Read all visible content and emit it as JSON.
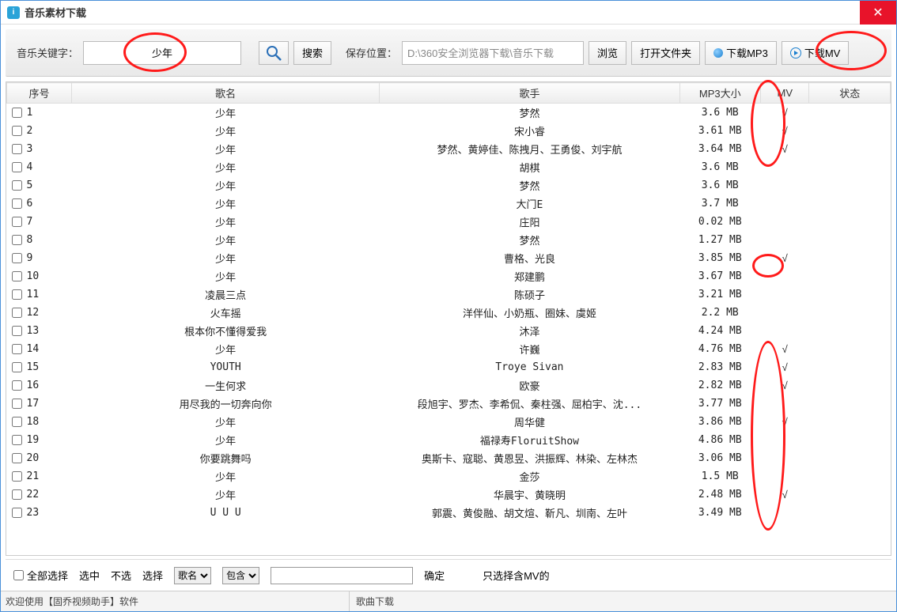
{
  "window": {
    "title": "音乐素材下载"
  },
  "toolbar": {
    "keyword_label": "音乐关键字：",
    "keyword_value": "少年",
    "search_label": "搜索",
    "save_label": "保存位置：",
    "save_path": "D:\\360安全浏览器下载\\音乐下载",
    "browse_label": "浏览",
    "open_folder_label": "打开文件夹",
    "download_mp3_label": "下载MP3",
    "download_mv_label": "下载MV"
  },
  "columns": {
    "seq": "序号",
    "name": "歌名",
    "artist": "歌手",
    "size": "MP3大小",
    "mv": "MV",
    "status": "状态"
  },
  "rows": [
    {
      "seq": "1",
      "name": "少年",
      "artist": "梦然",
      "size": "3.6 MB",
      "mv": "√"
    },
    {
      "seq": "2",
      "name": "少年",
      "artist": "宋小睿",
      "size": "3.61 MB",
      "mv": "√"
    },
    {
      "seq": "3",
      "name": "少年",
      "artist": "梦然、黄婷佳、陈拽月、王勇俊、刘宇航",
      "size": "3.64 MB",
      "mv": "√"
    },
    {
      "seq": "4",
      "name": "少年",
      "artist": "胡棋",
      "size": "3.6 MB",
      "mv": ""
    },
    {
      "seq": "5",
      "name": "少年",
      "artist": "梦然",
      "size": "3.6 MB",
      "mv": ""
    },
    {
      "seq": "6",
      "name": "少年",
      "artist": "大门E",
      "size": "3.7 MB",
      "mv": ""
    },
    {
      "seq": "7",
      "name": "少年",
      "artist": "庄阳",
      "size": "0.02 MB",
      "mv": ""
    },
    {
      "seq": "8",
      "name": "少年",
      "artist": "梦然",
      "size": "1.27 MB",
      "mv": ""
    },
    {
      "seq": "9",
      "name": "少年",
      "artist": "曹格、光良",
      "size": "3.85 MB",
      "mv": "√"
    },
    {
      "seq": "10",
      "name": "少年",
      "artist": "郑建鹏",
      "size": "3.67 MB",
      "mv": ""
    },
    {
      "seq": "11",
      "name": "凌晨三点",
      "artist": "陈硕子",
      "size": "3.21 MB",
      "mv": ""
    },
    {
      "seq": "12",
      "name": "火车摇",
      "artist": "洋伴仙、小奶瓶、圈妹、虞姬",
      "size": "2.2 MB",
      "mv": ""
    },
    {
      "seq": "13",
      "name": "根本你不懂得爱我",
      "artist": "沐泽",
      "size": "4.24 MB",
      "mv": ""
    },
    {
      "seq": "14",
      "name": "少年",
      "artist": "许巍",
      "size": "4.76 MB",
      "mv": "√"
    },
    {
      "seq": "15",
      "name": "YOUTH",
      "artist": "Troye Sivan",
      "size": "2.83 MB",
      "mv": "√"
    },
    {
      "seq": "16",
      "name": "一生何求",
      "artist": "欧豪",
      "size": "2.82 MB",
      "mv": "√"
    },
    {
      "seq": "17",
      "name": "用尽我的一切奔向你",
      "artist": "段旭宇、罗杰、李希侃、秦柱强、屈柏宇、沈...",
      "size": "3.77 MB",
      "mv": ""
    },
    {
      "seq": "18",
      "name": "少年",
      "artist": "周华健",
      "size": "3.86 MB",
      "mv": "√"
    },
    {
      "seq": "19",
      "name": "少年",
      "artist": "福禄寿FloruitShow",
      "size": "4.86 MB",
      "mv": ""
    },
    {
      "seq": "20",
      "name": "你要跳舞吗",
      "artist": "奥斯卡、寇聪、黄恩昱、洪振辉、林染、左林杰",
      "size": "3.06 MB",
      "mv": ""
    },
    {
      "seq": "21",
      "name": "少年",
      "artist": "金莎",
      "size": "1.5 MB",
      "mv": ""
    },
    {
      "seq": "22",
      "name": "少年",
      "artist": "华晨宇、黄晓明",
      "size": "2.48 MB",
      "mv": "√"
    },
    {
      "seq": "23",
      "name": "U U U",
      "artist": "郭震、黄俊融、胡文煊、靳凡、圳南、左叶",
      "size": "3.49 MB",
      "mv": ""
    }
  ],
  "filter": {
    "select_all": "全部选择",
    "select_on": "选中",
    "select_off": "不选",
    "select_label": "选择",
    "field_opt": "歌名",
    "cond_opt": "包含",
    "confirm": "确定",
    "mv_only": "只选择含MV的"
  },
  "status": {
    "left": "欢迎使用【固乔视频助手】软件",
    "right": "歌曲下载"
  }
}
